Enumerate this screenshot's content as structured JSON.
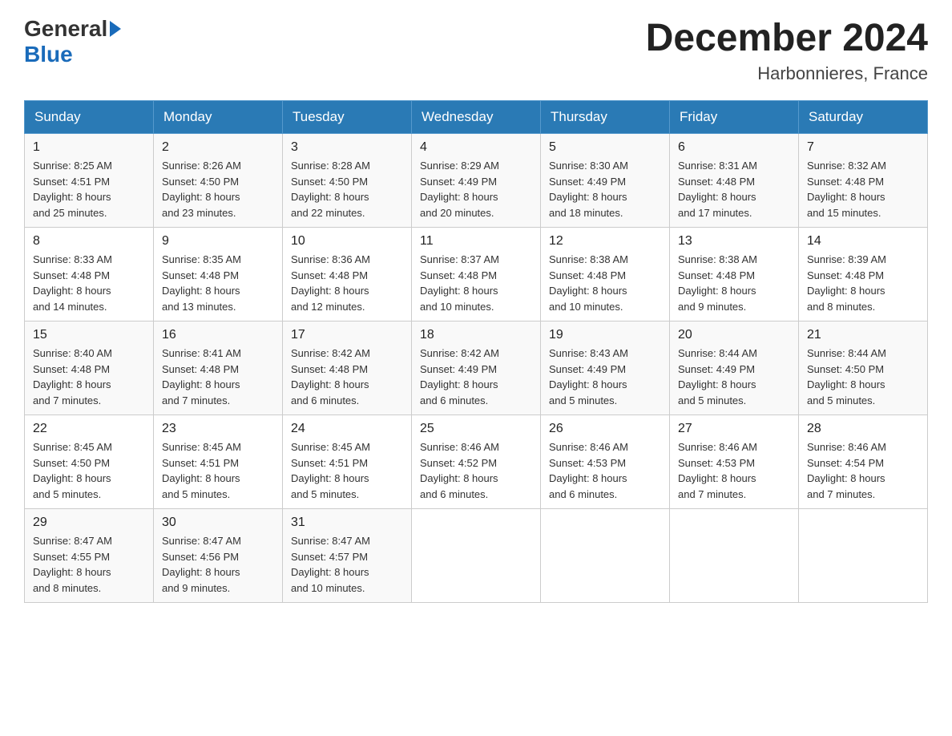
{
  "header": {
    "logo_general": "General",
    "logo_blue": "Blue",
    "month_title": "December 2024",
    "location": "Harbonnieres, France"
  },
  "columns": [
    "Sunday",
    "Monday",
    "Tuesday",
    "Wednesday",
    "Thursday",
    "Friday",
    "Saturday"
  ],
  "weeks": [
    [
      {
        "day": "1",
        "sunrise": "8:25 AM",
        "sunset": "4:51 PM",
        "daylight": "8 hours and 25 minutes."
      },
      {
        "day": "2",
        "sunrise": "8:26 AM",
        "sunset": "4:50 PM",
        "daylight": "8 hours and 23 minutes."
      },
      {
        "day": "3",
        "sunrise": "8:28 AM",
        "sunset": "4:50 PM",
        "daylight": "8 hours and 22 minutes."
      },
      {
        "day": "4",
        "sunrise": "8:29 AM",
        "sunset": "4:49 PM",
        "daylight": "8 hours and 20 minutes."
      },
      {
        "day": "5",
        "sunrise": "8:30 AM",
        "sunset": "4:49 PM",
        "daylight": "8 hours and 18 minutes."
      },
      {
        "day": "6",
        "sunrise": "8:31 AM",
        "sunset": "4:48 PM",
        "daylight": "8 hours and 17 minutes."
      },
      {
        "day": "7",
        "sunrise": "8:32 AM",
        "sunset": "4:48 PM",
        "daylight": "8 hours and 15 minutes."
      }
    ],
    [
      {
        "day": "8",
        "sunrise": "8:33 AM",
        "sunset": "4:48 PM",
        "daylight": "8 hours and 14 minutes."
      },
      {
        "day": "9",
        "sunrise": "8:35 AM",
        "sunset": "4:48 PM",
        "daylight": "8 hours and 13 minutes."
      },
      {
        "day": "10",
        "sunrise": "8:36 AM",
        "sunset": "4:48 PM",
        "daylight": "8 hours and 12 minutes."
      },
      {
        "day": "11",
        "sunrise": "8:37 AM",
        "sunset": "4:48 PM",
        "daylight": "8 hours and 10 minutes."
      },
      {
        "day": "12",
        "sunrise": "8:38 AM",
        "sunset": "4:48 PM",
        "daylight": "8 hours and 10 minutes."
      },
      {
        "day": "13",
        "sunrise": "8:38 AM",
        "sunset": "4:48 PM",
        "daylight": "8 hours and 9 minutes."
      },
      {
        "day": "14",
        "sunrise": "8:39 AM",
        "sunset": "4:48 PM",
        "daylight": "8 hours and 8 minutes."
      }
    ],
    [
      {
        "day": "15",
        "sunrise": "8:40 AM",
        "sunset": "4:48 PM",
        "daylight": "8 hours and 7 minutes."
      },
      {
        "day": "16",
        "sunrise": "8:41 AM",
        "sunset": "4:48 PM",
        "daylight": "8 hours and 7 minutes."
      },
      {
        "day": "17",
        "sunrise": "8:42 AM",
        "sunset": "4:48 PM",
        "daylight": "8 hours and 6 minutes."
      },
      {
        "day": "18",
        "sunrise": "8:42 AM",
        "sunset": "4:49 PM",
        "daylight": "8 hours and 6 minutes."
      },
      {
        "day": "19",
        "sunrise": "8:43 AM",
        "sunset": "4:49 PM",
        "daylight": "8 hours and 5 minutes."
      },
      {
        "day": "20",
        "sunrise": "8:44 AM",
        "sunset": "4:49 PM",
        "daylight": "8 hours and 5 minutes."
      },
      {
        "day": "21",
        "sunrise": "8:44 AM",
        "sunset": "4:50 PM",
        "daylight": "8 hours and 5 minutes."
      }
    ],
    [
      {
        "day": "22",
        "sunrise": "8:45 AM",
        "sunset": "4:50 PM",
        "daylight": "8 hours and 5 minutes."
      },
      {
        "day": "23",
        "sunrise": "8:45 AM",
        "sunset": "4:51 PM",
        "daylight": "8 hours and 5 minutes."
      },
      {
        "day": "24",
        "sunrise": "8:45 AM",
        "sunset": "4:51 PM",
        "daylight": "8 hours and 5 minutes."
      },
      {
        "day": "25",
        "sunrise": "8:46 AM",
        "sunset": "4:52 PM",
        "daylight": "8 hours and 6 minutes."
      },
      {
        "day": "26",
        "sunrise": "8:46 AM",
        "sunset": "4:53 PM",
        "daylight": "8 hours and 6 minutes."
      },
      {
        "day": "27",
        "sunrise": "8:46 AM",
        "sunset": "4:53 PM",
        "daylight": "8 hours and 7 minutes."
      },
      {
        "day": "28",
        "sunrise": "8:46 AM",
        "sunset": "4:54 PM",
        "daylight": "8 hours and 7 minutes."
      }
    ],
    [
      {
        "day": "29",
        "sunrise": "8:47 AM",
        "sunset": "4:55 PM",
        "daylight": "8 hours and 8 minutes."
      },
      {
        "day": "30",
        "sunrise": "8:47 AM",
        "sunset": "4:56 PM",
        "daylight": "8 hours and 9 minutes."
      },
      {
        "day": "31",
        "sunrise": "8:47 AM",
        "sunset": "4:57 PM",
        "daylight": "8 hours and 10 minutes."
      },
      null,
      null,
      null,
      null
    ]
  ],
  "labels": {
    "sunrise": "Sunrise:",
    "sunset": "Sunset:",
    "daylight": "Daylight:"
  }
}
